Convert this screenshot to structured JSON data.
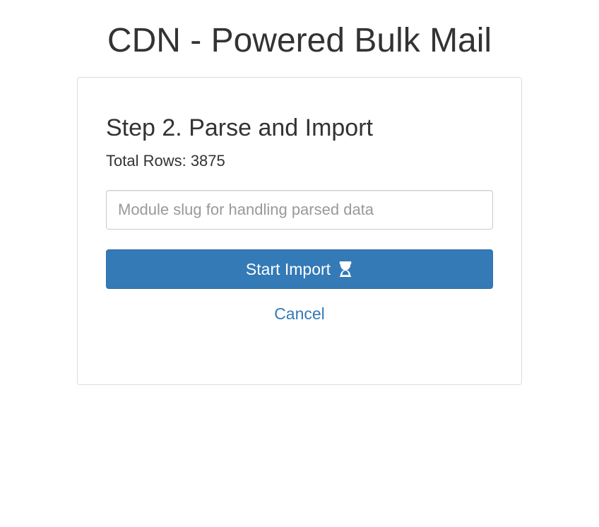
{
  "header": {
    "title": "CDN - Powered Bulk Mail"
  },
  "panel": {
    "step_heading": "Step 2. Parse and Import",
    "total_rows_text": "Total Rows: 3875",
    "total_rows_value": 3875,
    "module_input": {
      "placeholder": "Module slug for handling parsed data",
      "value": ""
    },
    "start_button_label": "Start Import",
    "cancel_button_label": "Cancel"
  },
  "icons": {
    "start_import": "hourglass-start-icon"
  },
  "colors": {
    "primary": "#337ab7",
    "primary_border": "#2e6da4",
    "text": "#333333",
    "border": "#dddddd"
  }
}
